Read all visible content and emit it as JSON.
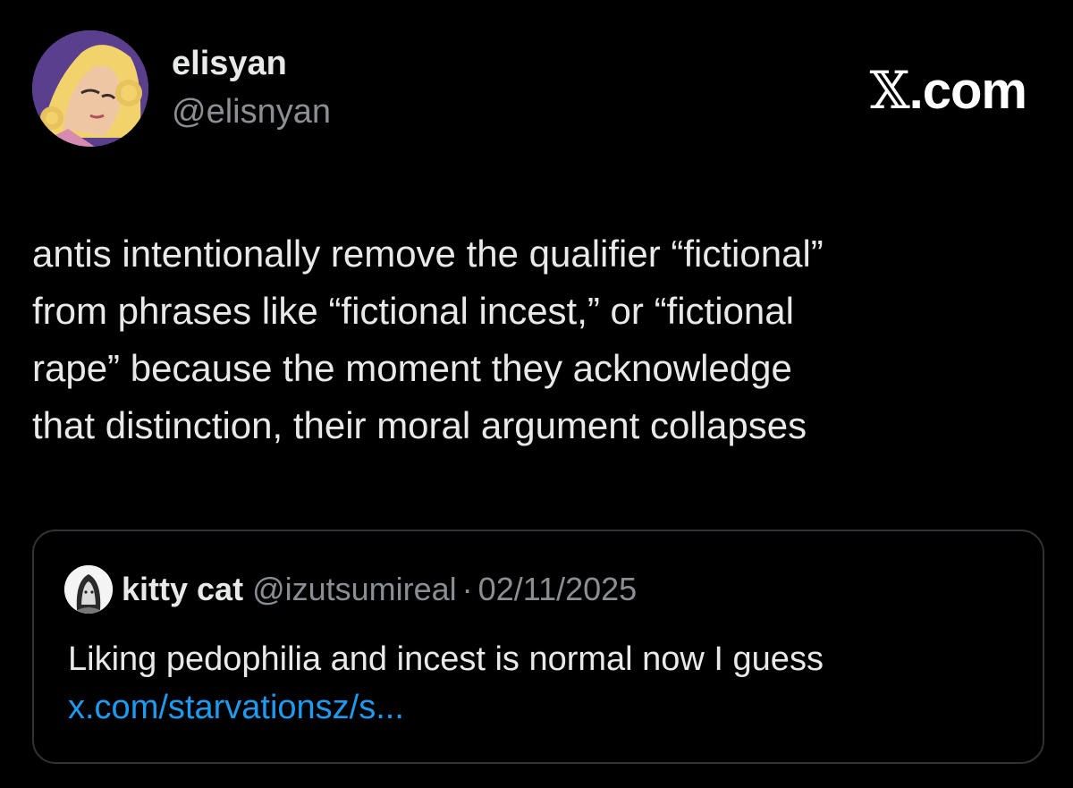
{
  "post": {
    "author_name": "elisyan",
    "author_handle": "@elisnyan",
    "brand": {
      "x": "𝕏",
      "rest": ".com"
    },
    "text": "antis intentionally remove the qualifier “fictional”\nfrom phrases like “fictional incest,” or “fictional\nrape” because the moment they acknowledge\nthat distinction, their moral argument collapses",
    "avatar_icon": "anime-character-avatar"
  },
  "quote": {
    "name": "kitty cat",
    "handle": "@izutsumireal",
    "separator": "·",
    "date": "02/11/2025",
    "text": "Liking pedophilia and incest is normal now I guess",
    "link": "x.com/starvationsz/s...",
    "avatar_icon": "sketch-character-avatar"
  },
  "colors": {
    "background": "#000000",
    "text_primary": "#e7e9ea",
    "text_secondary": "#8b8f94",
    "link": "#1d9bf0",
    "border": "#2f3336"
  }
}
